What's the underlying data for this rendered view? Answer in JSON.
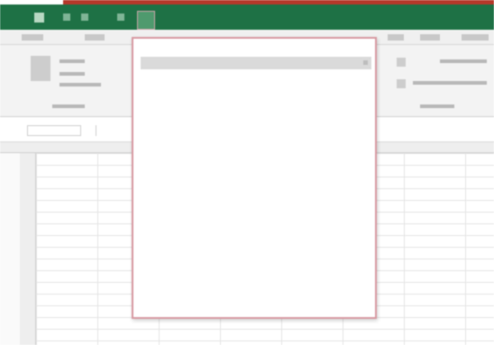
{
  "titlebar": {
    "title": ""
  },
  "namebox": {
    "value": ""
  },
  "dropdown": {
    "header": "",
    "items": [
      {
        "label": "",
        "checked": "",
        "active": true
      },
      {
        "label": "",
        "checked": ""
      },
      {
        "label": "",
        "checked": ""
      },
      {
        "label": "",
        "checked": ""
      },
      {
        "label": "",
        "checked": ""
      },
      {
        "label": "",
        "checked": ""
      },
      {
        "label": "",
        "checked": ""
      },
      {
        "label": "",
        "checked": ""
      },
      {
        "label": "",
        "checked": ""
      },
      {
        "label": "",
        "checked": ""
      },
      {
        "label": "",
        "checked": ""
      },
      {
        "label": "",
        "checked": ""
      },
      {
        "label": "",
        "checked": ""
      },
      {
        "label": "",
        "checked": ""
      }
    ]
  },
  "colors": {
    "titlebar": "#1e7145",
    "accent_red": "#b5382a",
    "dropdown_border": "#d89aa2"
  },
  "icons": [
    "excel-app-icon",
    "qat-icon",
    "qat-customize-icon"
  ]
}
